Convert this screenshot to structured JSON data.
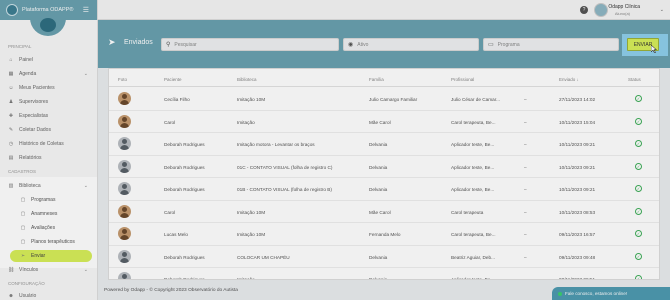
{
  "brand": {
    "name": "Plataforma ODAPP®",
    "menu_icon": "hamburger-icon"
  },
  "topbar": {
    "help_glyph": "?",
    "user_name": "Odapp Clínica",
    "user_role": "Aluno(a)"
  },
  "sidebar": {
    "section_main": "PRINCIPAL",
    "main_items": [
      {
        "label": "Painel",
        "icon": "home-icon"
      },
      {
        "label": "Agenda",
        "icon": "calendar-icon"
      },
      {
        "label": "Meus Pacientes",
        "icon": "patients-icon"
      },
      {
        "label": "Supervisores",
        "icon": "supervisor-icon"
      },
      {
        "label": "Especialistas",
        "icon": "specialist-icon"
      },
      {
        "label": "Coletar Dados",
        "icon": "pencil-icon"
      },
      {
        "label": "Histórico de Coletas",
        "icon": "history-icon"
      },
      {
        "label": "Relatórios",
        "icon": "report-icon"
      }
    ],
    "section_register": "CADASTROS",
    "library": {
      "label": "Biblioteca"
    },
    "library_items": [
      {
        "label": "Programas"
      },
      {
        "label": "Anamneses"
      },
      {
        "label": "Avaliações"
      },
      {
        "label": "Planos terapêuticos"
      },
      {
        "label": "Enviar"
      }
    ],
    "links": {
      "label": "Vínculos"
    },
    "section_config": "CONFIGURAÇÃO",
    "users": {
      "label": "Usuário"
    }
  },
  "page": {
    "title": "Enviados",
    "search_placeholder": "Pesquisar",
    "status_filter": "Ativo",
    "type_filter": "Programa",
    "send_button": "ENVIAR"
  },
  "table": {
    "headers": [
      "Foto",
      "Paciente",
      "Biblioteca",
      "Família",
      "Profissional",
      "Enviado ↓",
      "Status"
    ],
    "rows": [
      {
        "photo": "child",
        "patient": "Cecília Filho",
        "library": "Imitação 10M",
        "family": "Julio Camargo Familiar",
        "professional": "Julio César de Camar...",
        "dash": "–",
        "sent": "27/11/2023 14:02"
      },
      {
        "photo": "child",
        "patient": "Carol",
        "library": "Imitação",
        "family": "Mãe Carol",
        "professional": "Carol terapeuta, Be...",
        "dash": "–",
        "sent": "10/11/2023 15:04"
      },
      {
        "photo": "generic",
        "patient": "Deborah Rodrigues",
        "library": "Imitação motora - Levantar os braços",
        "family": "Delvania",
        "professional": "Aplicador teste, Be...",
        "dash": "–",
        "sent": "10/11/2023 09:21"
      },
      {
        "photo": "generic",
        "patient": "Deborah Rodrigues",
        "library": "01C - CONTATO VISUAL (folha de registro C)",
        "family": "Delvania",
        "professional": "Aplicador teste, Be...",
        "dash": "–",
        "sent": "10/11/2023 09:21"
      },
      {
        "photo": "generic",
        "patient": "Deborah Rodrigues",
        "library": "01B - CONTATO VISUAL (folha de registro B)",
        "family": "Delvania",
        "professional": "Aplicador teste, Be...",
        "dash": "–",
        "sent": "10/11/2023 09:21"
      },
      {
        "photo": "child",
        "patient": "Carol",
        "library": "Imitação 10M",
        "family": "Mãe Carol",
        "professional": "Carol terapeuta",
        "dash": "–",
        "sent": "10/11/2023 08:53"
      },
      {
        "photo": "child",
        "patient": "Lucas Melo",
        "library": "Imitação 10M",
        "family": "Fernanda Melo",
        "professional": "Carol terapeuta, Be...",
        "dash": "–",
        "sent": "09/11/2023 16:57"
      },
      {
        "photo": "generic",
        "patient": "Deborah Rodrigues",
        "library": "COLOCAR UM CHAPÉU",
        "family": "Delvania",
        "professional": "Beatriz Aguiar, Deb...",
        "dash": "–",
        "sent": "09/11/2023 09:48"
      },
      {
        "photo": "generic",
        "patient": "Deborah Rodrigues",
        "library": "Imitação",
        "family": "Delvania",
        "professional": "Aplicador teste, Be...",
        "dash": "–",
        "sent": "08/11/2023 09:51"
      }
    ]
  },
  "footer": {
    "text": "Powered by Odapp - © Copyright 2023 Observatório do Autista"
  },
  "chat": {
    "text": "Fale conosco, estamos online!"
  },
  "colors": {
    "brand": "#6aa1b0",
    "accent": "#d7ee5a",
    "status_ok": "#3fae5a"
  }
}
